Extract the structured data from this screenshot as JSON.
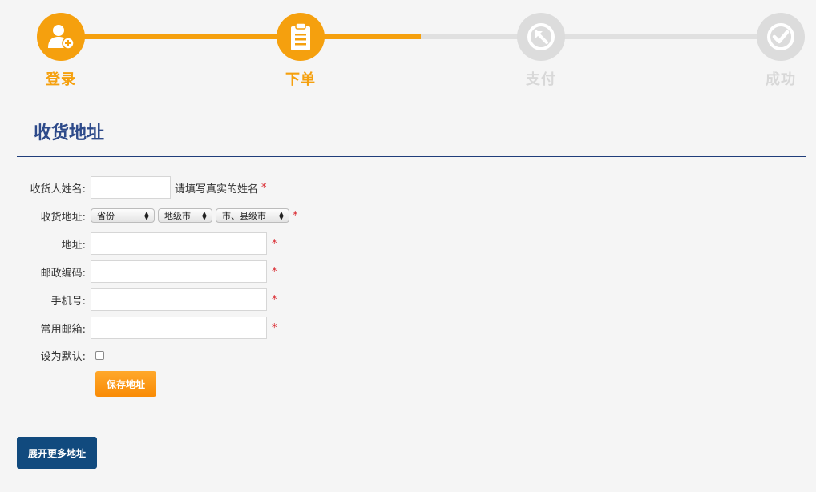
{
  "steps": [
    {
      "label": "登录",
      "icon": "user-add-icon",
      "state": "done"
    },
    {
      "label": "下单",
      "icon": "clipboard-icon",
      "state": "done"
    },
    {
      "label": "支付",
      "icon": "pay-icon",
      "state": "todo"
    },
    {
      "label": "成功",
      "icon": "check-icon",
      "state": "todo"
    }
  ],
  "progress_fraction": 0.5,
  "colors": {
    "accent": "#f5a00e",
    "inactive": "#dcdcdc",
    "title": "#2d4a8a",
    "primary_button": "#114a7e",
    "required": "#d9242b"
  },
  "section_title": "收货地址",
  "form": {
    "name": {
      "label": "收货人姓名:",
      "value": "",
      "hint": "请填写真实的姓名",
      "required_mark": "*"
    },
    "region": {
      "label": "收货地址:",
      "province": "省份",
      "city": "地级市",
      "county": "市、县级市",
      "required_mark": "*"
    },
    "address": {
      "label": "地址:",
      "value": "",
      "required_mark": "*"
    },
    "postcode": {
      "label": "邮政编码:",
      "value": "",
      "required_mark": "*"
    },
    "phone": {
      "label": "手机号:",
      "value": "",
      "required_mark": "*"
    },
    "email": {
      "label": "常用邮箱:",
      "value": "",
      "required_mark": "*"
    },
    "default": {
      "label": "设为默认:",
      "checked": false
    }
  },
  "buttons": {
    "save": "保存地址",
    "more": "展开更多地址"
  }
}
